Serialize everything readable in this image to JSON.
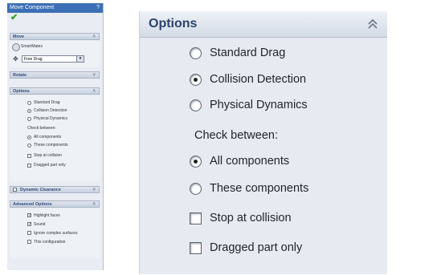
{
  "left_panel": {
    "title": "Move Component",
    "help_symbol": "?",
    "move": {
      "header": "Move",
      "smartmates_label": "SmartMates",
      "drag_mode": "Free Drag"
    },
    "rotate": {
      "header": "Rotate"
    },
    "options": {
      "header": "Options",
      "radios": [
        {
          "label": "Standard Drag",
          "selected": false
        },
        {
          "label": "Collision Detection",
          "selected": true
        },
        {
          "label": "Physical Dynamics",
          "selected": false
        }
      ],
      "check_between_label": "Check between:",
      "scope": [
        {
          "label": "All components",
          "selected": true
        },
        {
          "label": "These components",
          "selected": false
        }
      ],
      "checks": [
        {
          "label": "Stop at collision",
          "checked": false
        },
        {
          "label": "Dragged part only",
          "checked": false
        }
      ]
    },
    "dynamic_clearance": {
      "header": "Dynamic Clearance",
      "checked": false
    },
    "advanced": {
      "header": "Advanced Options",
      "checks": [
        {
          "label": "Highlight faces",
          "checked": true
        },
        {
          "label": "Sound",
          "checked": true
        },
        {
          "label": "Ignore complex surfaces",
          "checked": false
        },
        {
          "label": "This configuration",
          "checked": false
        }
      ]
    }
  },
  "options_panel": {
    "title": "Options",
    "radios": [
      {
        "label": "Standard Drag",
        "selected": false
      },
      {
        "label": "Collision Detection",
        "selected": true
      },
      {
        "label": "Physical Dynamics",
        "selected": false
      }
    ],
    "check_between_label": "Check between:",
    "scope": [
      {
        "label": "All components",
        "selected": true
      },
      {
        "label": "These components",
        "selected": false
      }
    ],
    "checks": [
      {
        "label": "Stop at collision",
        "checked": false
      },
      {
        "label": "Dragged part only",
        "checked": false
      }
    ]
  },
  "colors": {
    "title_bar": "#3c6fb5",
    "header_text": "#2b426b",
    "ok_check": "#2f9a24"
  }
}
